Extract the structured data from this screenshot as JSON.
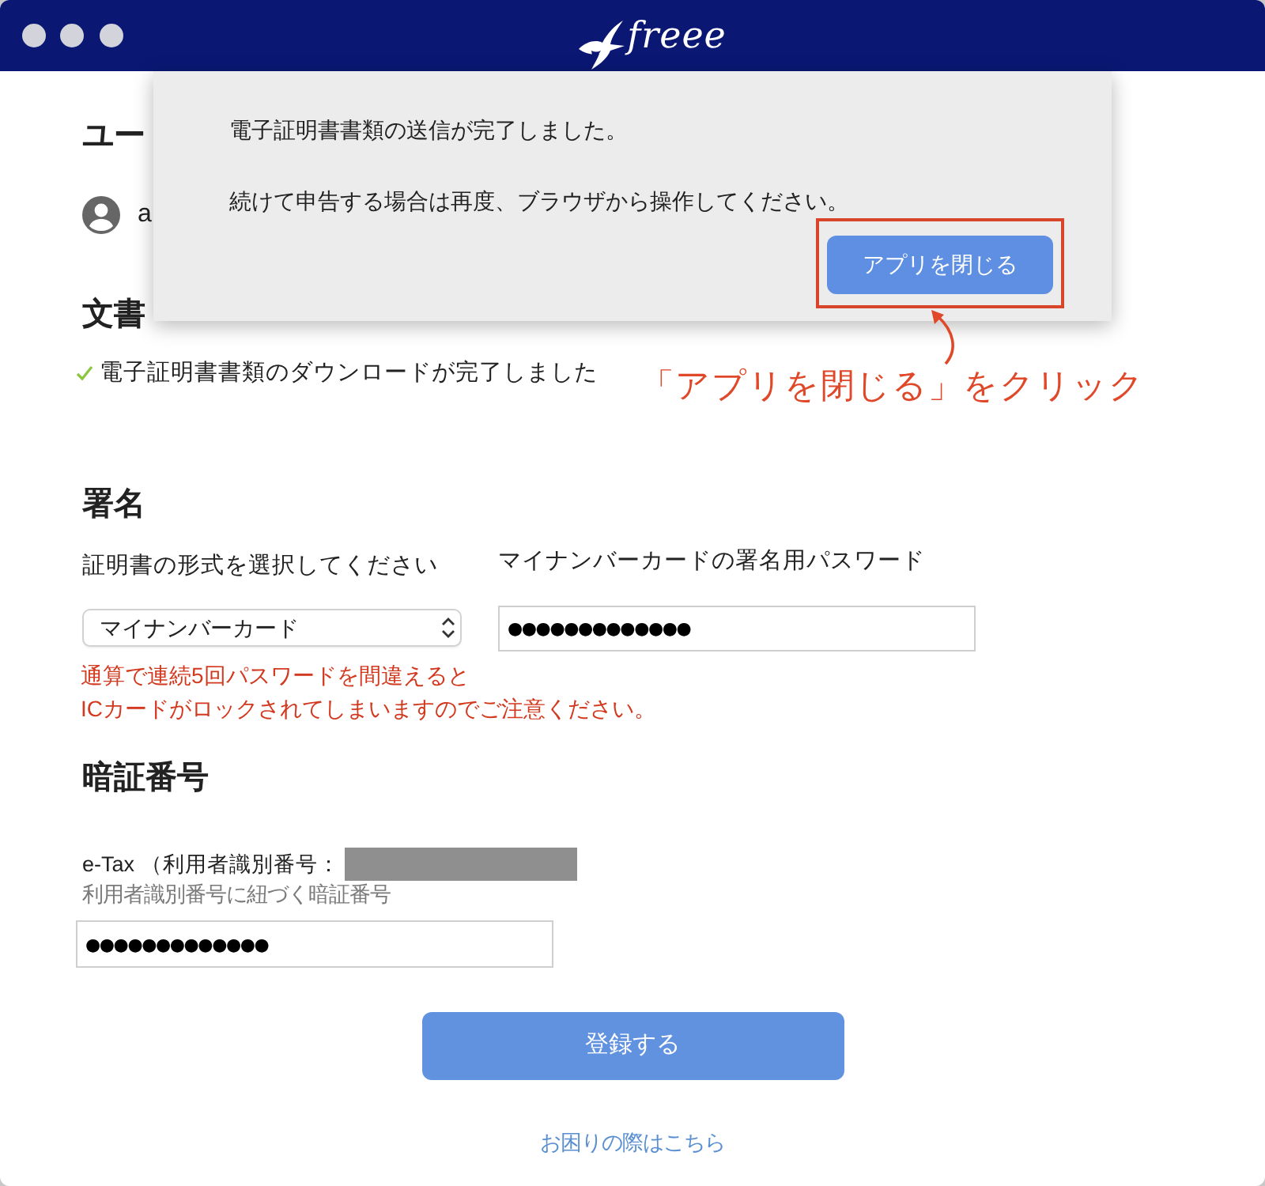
{
  "logo": {
    "text": "freee"
  },
  "user_section": {
    "heading": "ユー",
    "account": "a"
  },
  "documents_section": {
    "heading": "文書",
    "status": "電子証明書書類のダウンロードが完了しました"
  },
  "signature_section": {
    "heading": "署名",
    "format_label": "証明書の形式を選択してください",
    "format_value": "マイナンバーカード",
    "password_label": "マイナンバーカードの署名用パスワード",
    "password_value": "●●●●●●●●●●●●●",
    "warning_lines": [
      "通算で連続5回パスワードを間違えると",
      "ICカードがロックされてしまいますのでご注意ください。"
    ]
  },
  "pin_section": {
    "heading": "暗証番号",
    "etax_label": "e-Tax （利用者識別番号：",
    "hint": "利用者識別番号に紐づく暗証番号",
    "pin_value": "●●●●●●●●●●●●●"
  },
  "submit_button": "登録する",
  "help_link": "お困りの際はこちら",
  "dialog": {
    "lines": [
      "電子証明書書類の送信が完了しました。",
      "続けて申告する場合は再度、ブラウザから操作してください。"
    ],
    "button": "アプリを閉じる"
  },
  "annotation": {
    "text": "「アプリを閉じる」をクリック"
  }
}
